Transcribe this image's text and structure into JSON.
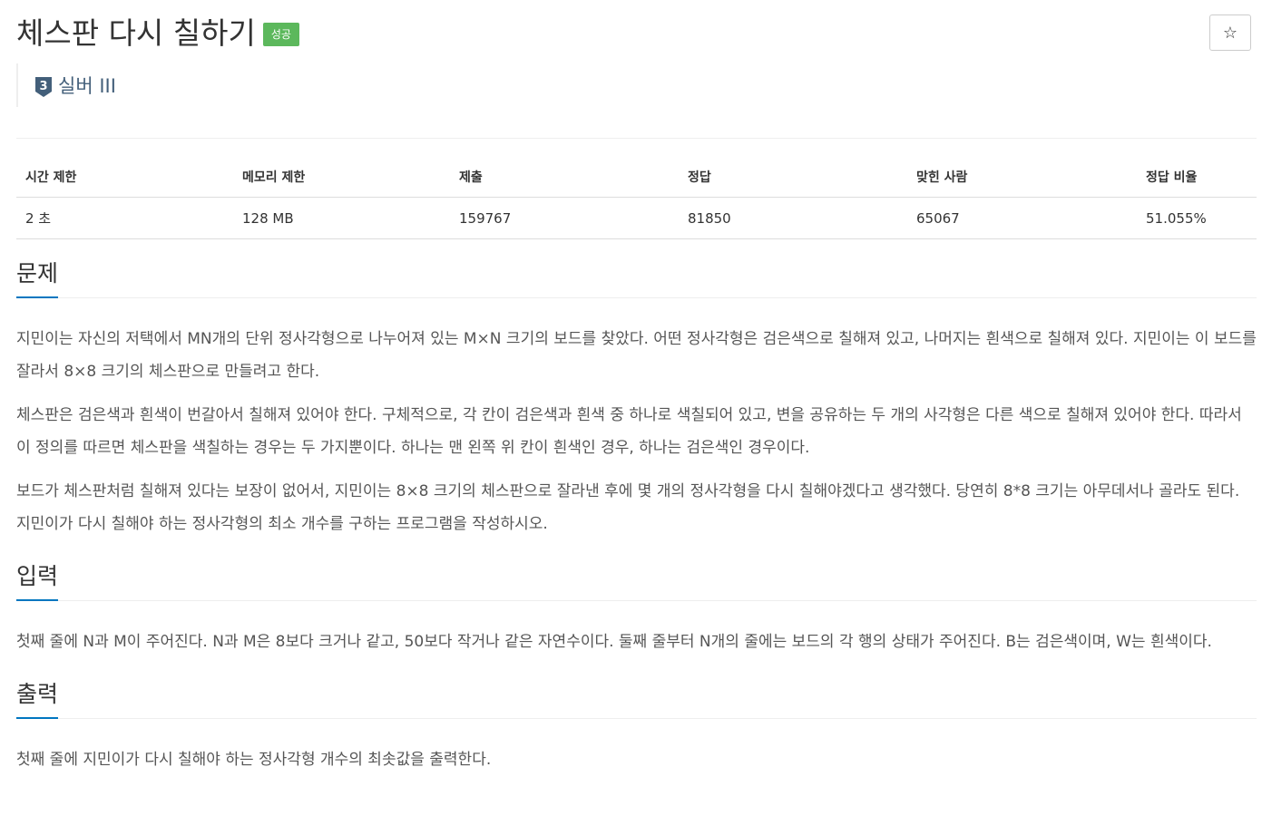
{
  "problem": {
    "title": "체스판 다시 칠하기",
    "result_badge": "성공",
    "star_label": "☆",
    "tier": {
      "number": "3",
      "label": "실버 III",
      "color": "#435f7a"
    }
  },
  "info_table": {
    "headers": [
      "시간 제한",
      "메모리 제한",
      "제출",
      "정답",
      "맞힌 사람",
      "정답 비율"
    ],
    "values": [
      "2 초",
      "128 MB",
      "159767",
      "81850",
      "65067",
      "51.055%"
    ]
  },
  "sections": {
    "description": {
      "title": "문제",
      "paragraphs": [
        "지민이는 자신의 저택에서 MN개의 단위 정사각형으로 나누어져 있는 M×N 크기의 보드를 찾았다. 어떤 정사각형은 검은색으로 칠해져 있고, 나머지는 흰색으로 칠해져 있다. 지민이는 이 보드를 잘라서 8×8 크기의 체스판으로 만들려고 한다.",
        "체스판은 검은색과 흰색이 번갈아서 칠해져 있어야 한다. 구체적으로, 각 칸이 검은색과 흰색 중 하나로 색칠되어 있고, 변을 공유하는 두 개의 사각형은 다른 색으로 칠해져 있어야 한다. 따라서 이 정의를 따르면 체스판을 색칠하는 경우는 두 가지뿐이다. 하나는 맨 왼쪽 위 칸이 흰색인 경우, 하나는 검은색인 경우이다.",
        "보드가 체스판처럼 칠해져 있다는 보장이 없어서, 지민이는 8×8 크기의 체스판으로 잘라낸 후에 몇 개의 정사각형을 다시 칠해야겠다고 생각했다. 당연히 8*8 크기는 아무데서나 골라도 된다. 지민이가 다시 칠해야 하는 정사각형의 최소 개수를 구하는 프로그램을 작성하시오."
      ]
    },
    "input": {
      "title": "입력",
      "paragraphs": [
        "첫째 줄에 N과 M이 주어진다. N과 M은 8보다 크거나 같고, 50보다 작거나 같은 자연수이다. 둘째 줄부터 N개의 줄에는 보드의 각 행의 상태가 주어진다. B는 검은색이며, W는 흰색이다."
      ]
    },
    "output": {
      "title": "출력",
      "paragraphs": [
        "첫째 줄에 지민이가 다시 칠해야 하는 정사각형 개수의 최솟값을 출력한다."
      ]
    }
  },
  "colors": {
    "success": "#5cb85c",
    "accent": "#0076c0"
  }
}
